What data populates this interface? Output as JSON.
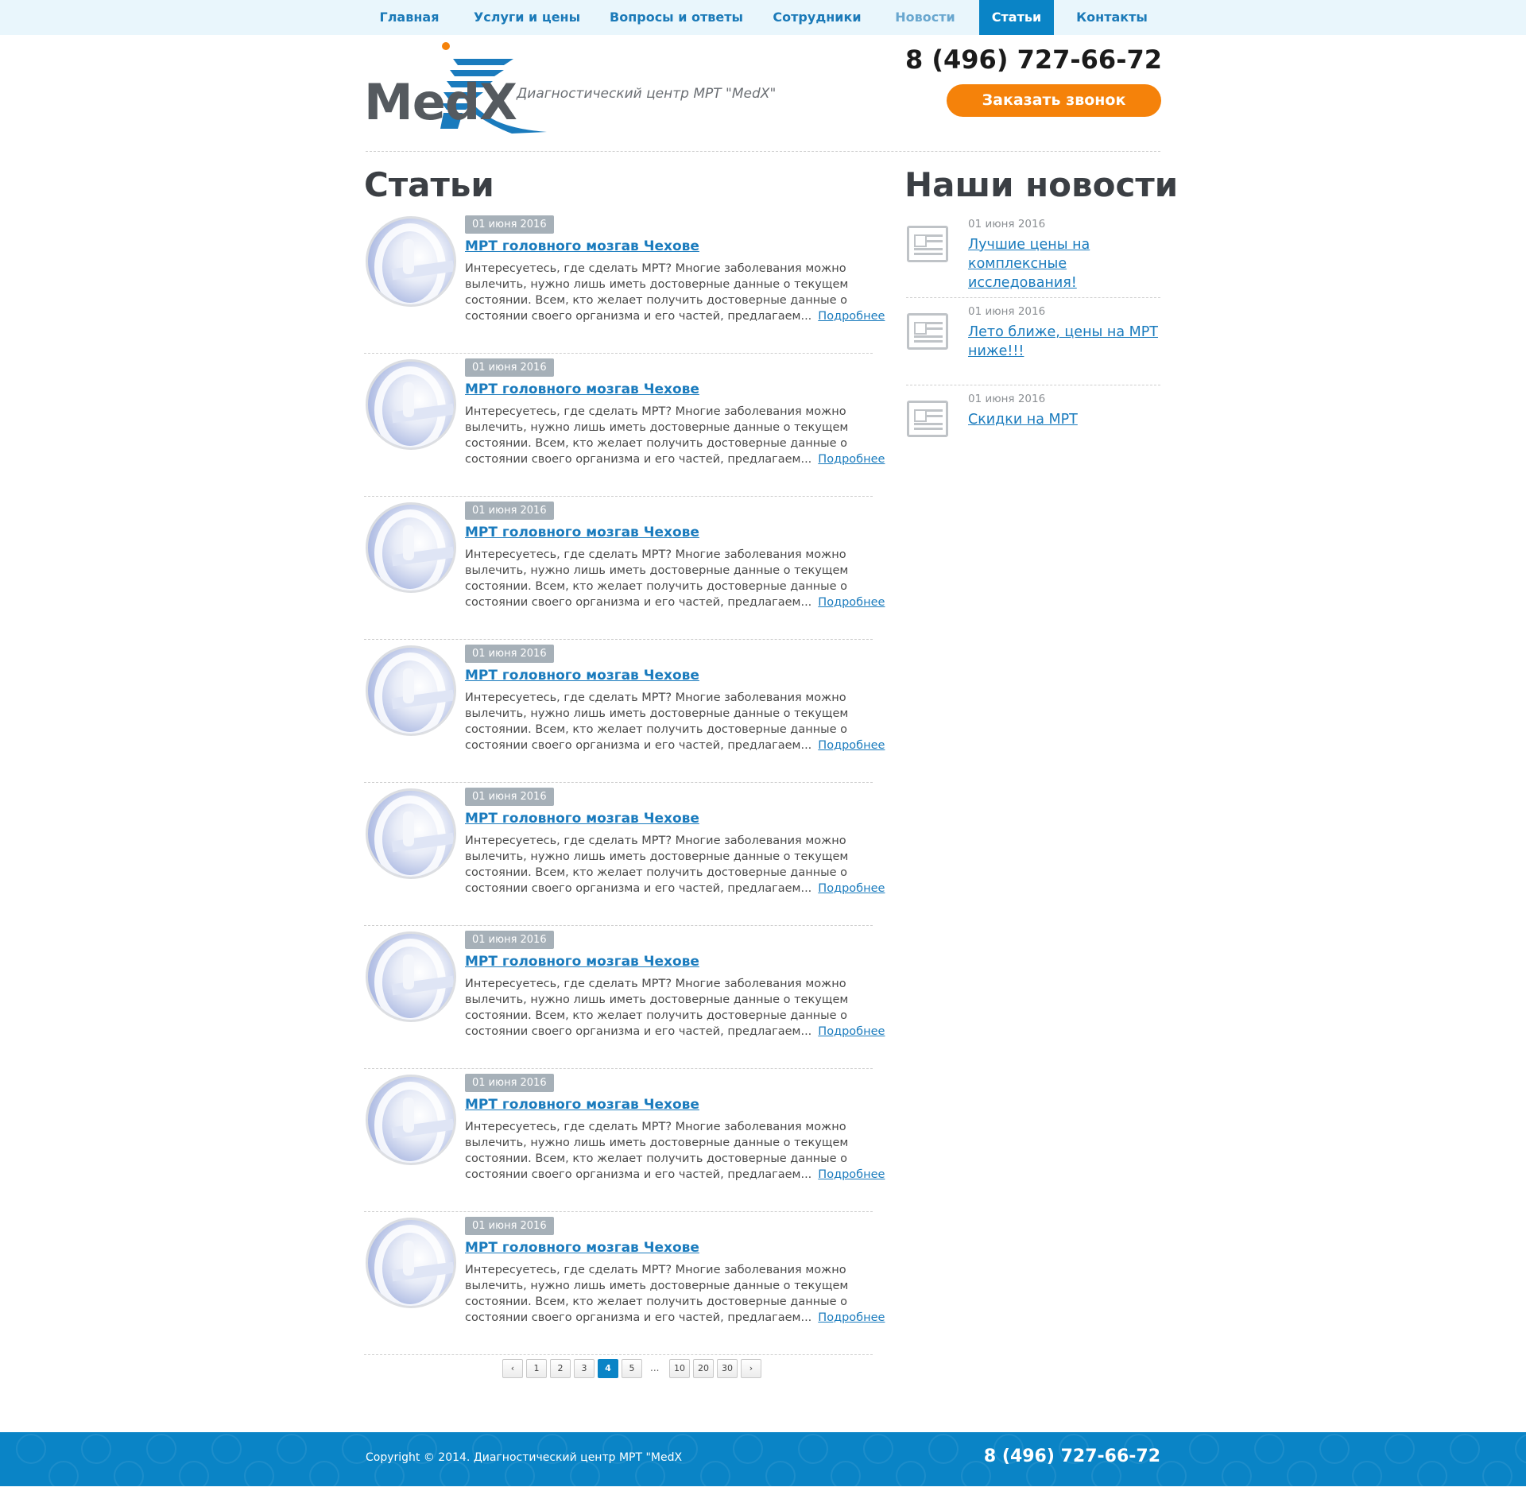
{
  "nav": {
    "items": [
      {
        "label": "Главная"
      },
      {
        "label": "Услуги и цены"
      },
      {
        "label": "Вопросы и ответы"
      },
      {
        "label": "Сотрудники"
      },
      {
        "label": "Новости"
      },
      {
        "label": "Статьи"
      },
      {
        "label": "Контакты"
      }
    ],
    "active_index": 5
  },
  "header": {
    "logo_text": "MedX",
    "tagline": "Диагностический центр МРТ \"MedX\"",
    "phone": "8 (496) 727-66-72",
    "callback_label": "Заказать звонок"
  },
  "articles": {
    "title": "Статьи",
    "more_label": "Подробнее",
    "items": [
      {
        "date": "01 июня 2016",
        "title": "МРТ головного мозгав Чехове",
        "text": "Интересуетесь, где сделать МРТ? Многие заболевания можно вылечить, нужно лишь иметь достоверные данные о текущем состоянии. Всем, кто желает получить достоверные данные о состоянии своего организма и его частей, предлагаем..."
      },
      {
        "date": "01 июня 2016",
        "title": "МРТ головного мозгав Чехове",
        "text": "Интересуетесь, где сделать МРТ? Многие заболевания можно вылечить, нужно лишь иметь достоверные данные о текущем состоянии. Всем, кто желает получить достоверные данные о состоянии своего организма и его частей, предлагаем..."
      },
      {
        "date": "01 июня 2016",
        "title": "МРТ головного мозгав Чехове",
        "text": "Интересуетесь, где сделать МРТ? Многие заболевания можно вылечить, нужно лишь иметь достоверные данные о текущем состоянии. Всем, кто желает получить достоверные данные о состоянии своего организма и его частей, предлагаем..."
      },
      {
        "date": "01 июня 2016",
        "title": "МРТ головного мозгав Чехове",
        "text": "Интересуетесь, где сделать МРТ? Многие заболевания можно вылечить, нужно лишь иметь достоверные данные о текущем состоянии. Всем, кто желает получить достоверные данные о состоянии своего организма и его частей, предлагаем..."
      },
      {
        "date": "01 июня 2016",
        "title": "МРТ головного мозгав Чехове",
        "text": "Интересуетесь, где сделать МРТ? Многие заболевания можно вылечить, нужно лишь иметь достоверные данные о текущем состоянии. Всем, кто желает получить достоверные данные о состоянии своего организма и его частей, предлагаем..."
      },
      {
        "date": "01 июня 2016",
        "title": "МРТ головного мозгав Чехове",
        "text": "Интересуетесь, где сделать МРТ? Многие заболевания можно вылечить, нужно лишь иметь достоверные данные о текущем состоянии. Всем, кто желает получить достоверные данные о состоянии своего организма и его частей, предлагаем..."
      },
      {
        "date": "01 июня 2016",
        "title": "МРТ головного мозгав Чехове",
        "text": "Интересуетесь, где сделать МРТ? Многие заболевания можно вылечить, нужно лишь иметь достоверные данные о текущем состоянии. Всем, кто желает получить достоверные данные о состоянии своего организма и его частей, предлагаем..."
      },
      {
        "date": "01 июня 2016",
        "title": "МРТ головного мозгав Чехове",
        "text": "Интересуетесь, где сделать МРТ? Многие заболевания можно вылечить, нужно лишь иметь достоверные данные о текущем состоянии. Всем, кто желает получить достоверные данные о состоянии своего организма и его частей, предлагаем..."
      }
    ]
  },
  "pagination": {
    "prev_label": "‹",
    "next_label": "›",
    "pages": [
      "1",
      "2",
      "3",
      "4",
      "5",
      "...",
      "10",
      "20",
      "30"
    ],
    "current": "4"
  },
  "news": {
    "title": "Наши новости",
    "items": [
      {
        "date": "01 июня 2016",
        "title": "Лучшие цены на комплексные исследования!"
      },
      {
        "date": "01 июня 2016",
        "title": "Лето ближе, цены на МРТ ниже!!!"
      },
      {
        "date": "01 июня 2016",
        "title": "Скидки на МРТ"
      }
    ]
  },
  "footer": {
    "copyright": "Copyright © 2014. Диагностический центр МРТ \"MedX",
    "phone": "8 (496) 727-66-72"
  },
  "colors": {
    "accent_blue": "#0a84c6",
    "link_blue": "#1a7bbd",
    "callback_orange": "#f5820a",
    "nav_bg": "#e9f6fc"
  }
}
